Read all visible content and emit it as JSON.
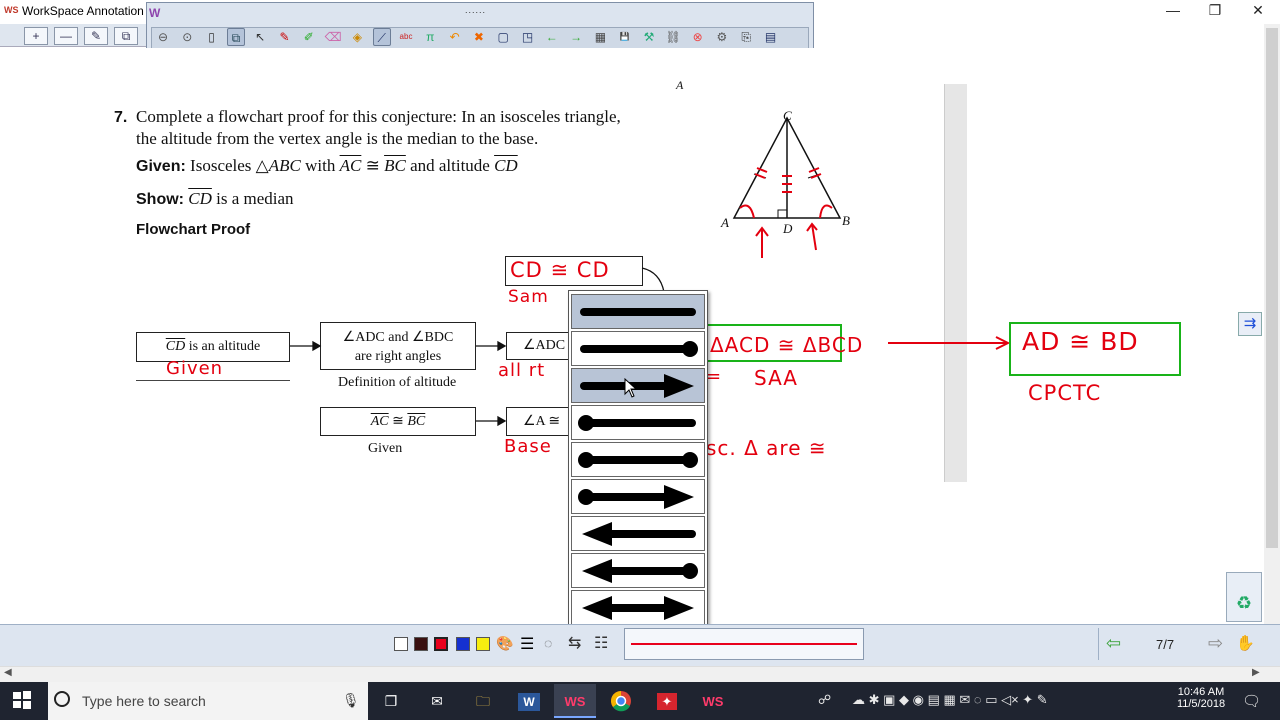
{
  "window": {
    "title": "WorkSpace Annotation -",
    "app_badge": "WS",
    "float_badge": "W",
    "grip": "......",
    "controls": {
      "minimize": "—",
      "restore": "❐",
      "close": "✕"
    }
  },
  "left_tools": [
    "+",
    "—",
    "✎",
    "⧉"
  ],
  "toolbar_icons": [
    "minus-circle-icon",
    "chevron-down-circle-icon",
    "mouse-icon",
    "pages-icon",
    "pointer-icon",
    "red-pen-icon",
    "green-marker-icon",
    "eraser-icon",
    "shapes-icon",
    "line-tool-icon",
    "spell-check-icon",
    "math-icon",
    "undo-arrow-icon",
    "clear-x-icon",
    "new-page-icon",
    "snapshot-icon",
    "back-arrow-icon",
    "forward-arrow-icon",
    "keyboard-icon",
    "save-icon",
    "tools-icon",
    "link-icon",
    "close-circle-icon",
    "settings-icon",
    "camera-icon",
    "document-icon"
  ],
  "document": {
    "problem_number": "7.",
    "line1": "Complete a flowchart proof for this conjecture: In an isosceles triangle,",
    "line2": "the altitude from the vertex angle is the median to the base.",
    "given_label": "Given:",
    "given_pre": "Isosceles △",
    "given_abc": "ABC",
    "given_mid": " with ",
    "ac": "AC",
    "cong": " ≅ ",
    "bc": "BC",
    "given_and": " and altitude ",
    "cd": "CD",
    "show_label": "Show:",
    "show_rest": " is a median",
    "proof_heading": "Flowchart Proof",
    "top_letter": "A"
  },
  "triangle": {
    "C": "C",
    "A": "A",
    "B": "B",
    "D": "D"
  },
  "flowchart": {
    "box1_bar": "CD",
    "box1_rest": " is an altitude",
    "box2_line1": "∠ADC and ∠BDC",
    "box2_line2": "are right angles",
    "box2_reason": "Definition of altitude",
    "box3": "∠ADC",
    "box4_ac": "AC",
    "box4_cong": " ≅ ",
    "box4_bc": "BC",
    "box4_reason": "Given",
    "box5": "∠A ≅"
  },
  "annotations": {
    "given": "Given",
    "cd_cong": "CD ≅ CD",
    "same": "Sam",
    "all_rt": "all rt",
    "base": "Base",
    "isos": "sc. Δ are ≅",
    "acd_bcd": "ΔACD ≅ ΔBCD",
    "saa": "SAA",
    "ad_bd": "AD ≅ BD",
    "cpctc": "CPCTC",
    "tick_eq": "="
  },
  "line_styles": [
    "plain-line",
    "line-dot-end",
    "line-arrow-end",
    "dot-line",
    "dot-line-dot",
    "dot-line-arrow",
    "arrow-line",
    "arrow-line-dot",
    "double-arrow"
  ],
  "selected_line_style": 2,
  "page": {
    "indicator": "7/7"
  },
  "colors": {
    "white": "#ffffff",
    "dark": "#3a1010",
    "red": "#e8001c",
    "blue": "#1530d0",
    "yellow": "#f7ee10",
    "ink": "#e3000f",
    "green_box": "#19b319"
  },
  "taskbar": {
    "search_placeholder": "Type here to search",
    "time": "10:46 AM",
    "date": "11/5/2018",
    "apps": [
      "task-view-icon",
      "mail-icon",
      "file-explorer-icon",
      "word-icon",
      "workspace-icon",
      "chrome-icon",
      "acrobat-icon",
      "workspace-icon-2"
    ],
    "word_label": "W",
    "ws_label": "WS",
    "ws2_label": "WS"
  }
}
